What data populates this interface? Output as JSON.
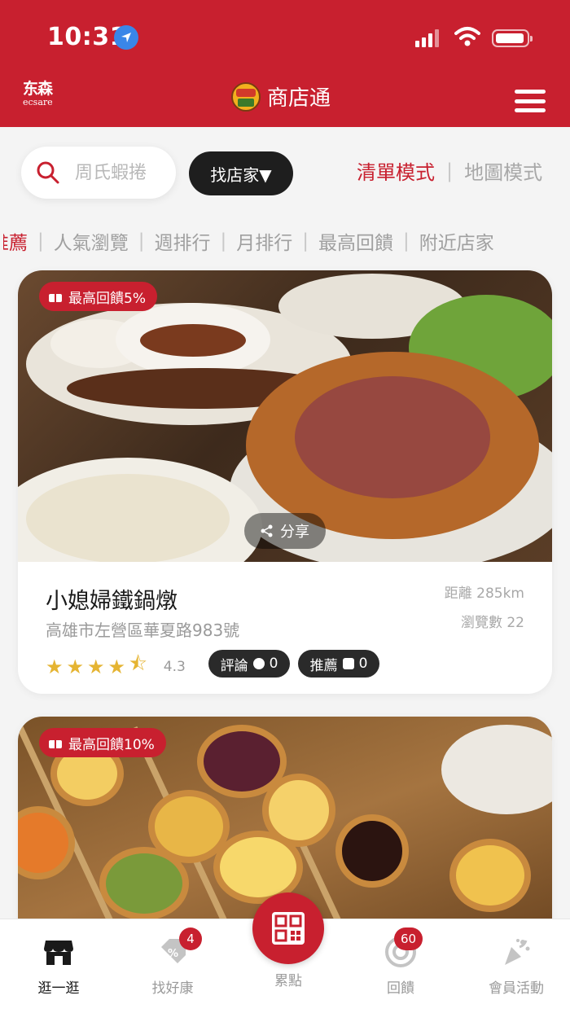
{
  "status_bar": {
    "time": "10:31"
  },
  "header": {
    "brand_cn": "东森",
    "brand_en": "ecsare",
    "title": "商店通"
  },
  "search": {
    "placeholder": "周氏蝦捲"
  },
  "find_store_label": "找店家▼",
  "view_mode": {
    "list": "清單模式",
    "separator": "|",
    "map": "地圖模式"
  },
  "rank_tabs": [
    "推薦",
    "人氣瀏覽",
    "週排行",
    "月排行",
    "最高回饋",
    "附近店家"
  ],
  "shops": [
    {
      "badge": "最高回饋5%",
      "share_label": "分享",
      "name": "小媳婦鐵鍋燉",
      "address": "高雄市左營區華夏路983號",
      "distance": "距離 285km",
      "views": "瀏覽數 22",
      "rating": "4.3",
      "review_label": "評論",
      "review_count": "0",
      "recommend_label": "推薦",
      "recommend_count": "0"
    },
    {
      "badge": "最高回饋10%"
    }
  ],
  "bottom_nav": {
    "browse": "逛一逛",
    "deals": "找好康",
    "deals_badge": "4",
    "points": "累點",
    "rewards": "回饋",
    "rewards_badge": "60",
    "events": "會員活動"
  },
  "colors": {
    "primary": "#c8202f",
    "dark_button": "#1e1e1e",
    "star": "#e5b432"
  },
  "icons": [
    "location-arrow-icon",
    "signal-icon",
    "wifi-icon",
    "battery-icon",
    "menu-icon",
    "search-icon",
    "gift-icon",
    "share-icon",
    "star-icon",
    "chat-icon",
    "thumbs-up-icon",
    "store-icon",
    "discount-tag-icon",
    "qr-code-icon",
    "coin-icon",
    "party-popper-icon"
  ]
}
